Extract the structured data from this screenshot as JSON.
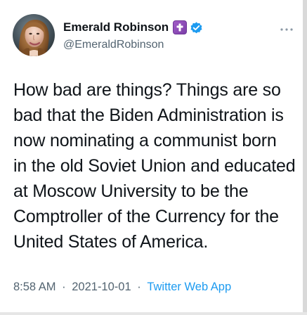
{
  "tweet": {
    "author": {
      "display_name": "Emerald Robinson",
      "handle": "@EmeraldRobinson",
      "badge_icon": "cross-emoji-icon",
      "verified_icon": "verified-badge-icon"
    },
    "text_lines": [
      "How bad are things? Things are so",
      "bad that the Biden Administration is",
      "now nominating a communist born",
      "in the old Soviet Union and educated",
      "at Moscow University to be the",
      "Comptroller of the Currency for the",
      "United States of America."
    ],
    "meta": {
      "time": "8:58 AM",
      "separator": "·",
      "date": "2021-10-01",
      "client": "Twitter Web App"
    },
    "menu_icon": "more-horizontal-icon"
  },
  "colors": {
    "text": "#0f1419",
    "secondary_text": "#536471",
    "link": "#1d9bf0",
    "verified": "#1d9bf0",
    "badge": "#8e4bb8"
  }
}
